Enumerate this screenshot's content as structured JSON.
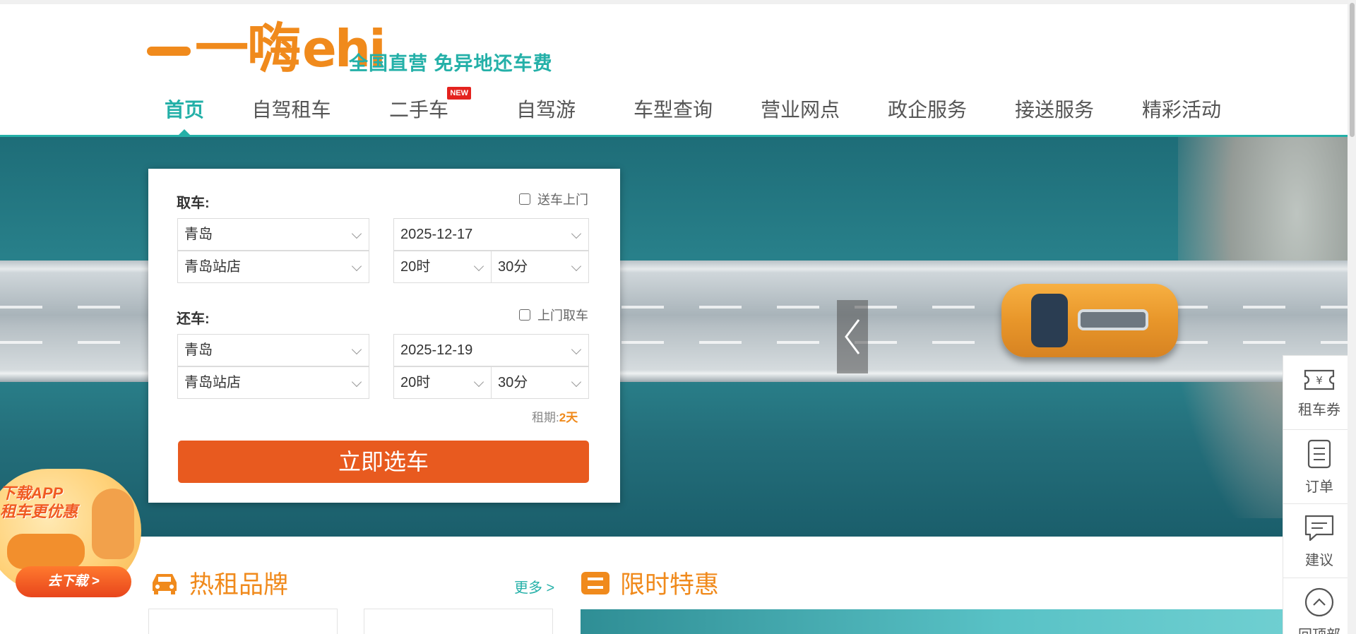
{
  "header": {
    "logo_cn": "一嗨",
    "logo_en": "ehi",
    "slogan": "全国直营  免异地还车费"
  },
  "nav": {
    "items": [
      {
        "label": "首页",
        "active": true
      },
      {
        "label": "自驾租车"
      },
      {
        "label": "二手车",
        "badge": "NEW"
      },
      {
        "label": "自驾游"
      },
      {
        "label": "车型查询"
      },
      {
        "label": "营业网点"
      },
      {
        "label": "政企服务"
      },
      {
        "label": "接送服务"
      },
      {
        "label": "精彩活动"
      }
    ]
  },
  "booking": {
    "pickup": {
      "label": "取车:",
      "option_label": "送车上门",
      "city": "青岛",
      "store": "青岛站店",
      "date": "2025-12-17",
      "hour": "20时",
      "minute": "30分"
    },
    "return": {
      "label": "还车:",
      "option_label": "上门取车",
      "city": "青岛",
      "store": "青岛站店",
      "date": "2025-12-19",
      "hour": "20时",
      "minute": "30分"
    },
    "rent_days_label": "租期:",
    "rent_days_value": "2天",
    "submit_label": "立即选车"
  },
  "promo": {
    "line1": "下载APP",
    "line2": "租车更优惠",
    "button": "去下载 >"
  },
  "sections": {
    "hot_brands": "热租品牌",
    "more": "更多 >",
    "deals": "限时特惠"
  },
  "sidebar": {
    "items": [
      {
        "label": "租车券",
        "icon": "coupon-icon"
      },
      {
        "label": "订单",
        "icon": "order-icon"
      },
      {
        "label": "建议",
        "icon": "feedback-icon"
      },
      {
        "label": "回顶部",
        "icon": "back-to-top-icon"
      }
    ]
  },
  "colors": {
    "brand_orange": "#f08a1c",
    "teal": "#24b0a8",
    "cta": "#e85a1f"
  }
}
